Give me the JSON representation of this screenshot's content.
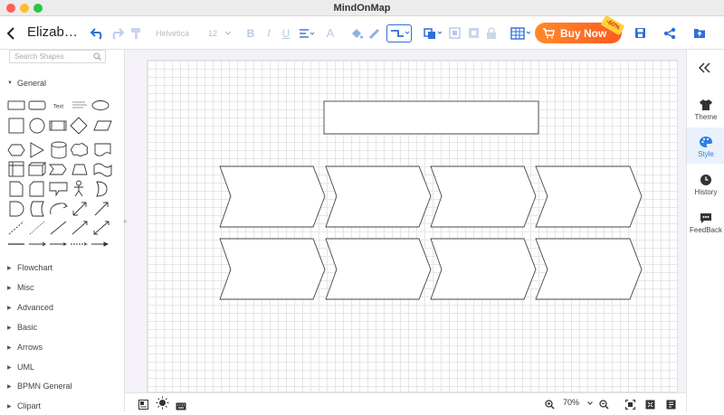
{
  "window": {
    "title": "MindOnMap"
  },
  "toolbar": {
    "doc_name": "Elizab…",
    "font_family": "Helvetica",
    "font_size": "12",
    "buy_label": "Buy Now",
    "discount": "-60%"
  },
  "sidebar": {
    "search_placeholder": "Search Shapes",
    "general_label": "General",
    "text_shape_label": "Text",
    "categories": [
      "Flowchart",
      "Misc",
      "Advanced",
      "Basic",
      "Arrows",
      "UML",
      "BPMN General",
      "Clipart"
    ]
  },
  "status": {
    "zoom": "70%"
  },
  "right_panel": {
    "items": [
      "Theme",
      "Style",
      "History",
      "FeedBack"
    ],
    "active": "Style"
  },
  "colors": {
    "accent": "#2f7fe0",
    "buy": "#ff6a1f",
    "canvas_bg": "#f5f1f8"
  }
}
